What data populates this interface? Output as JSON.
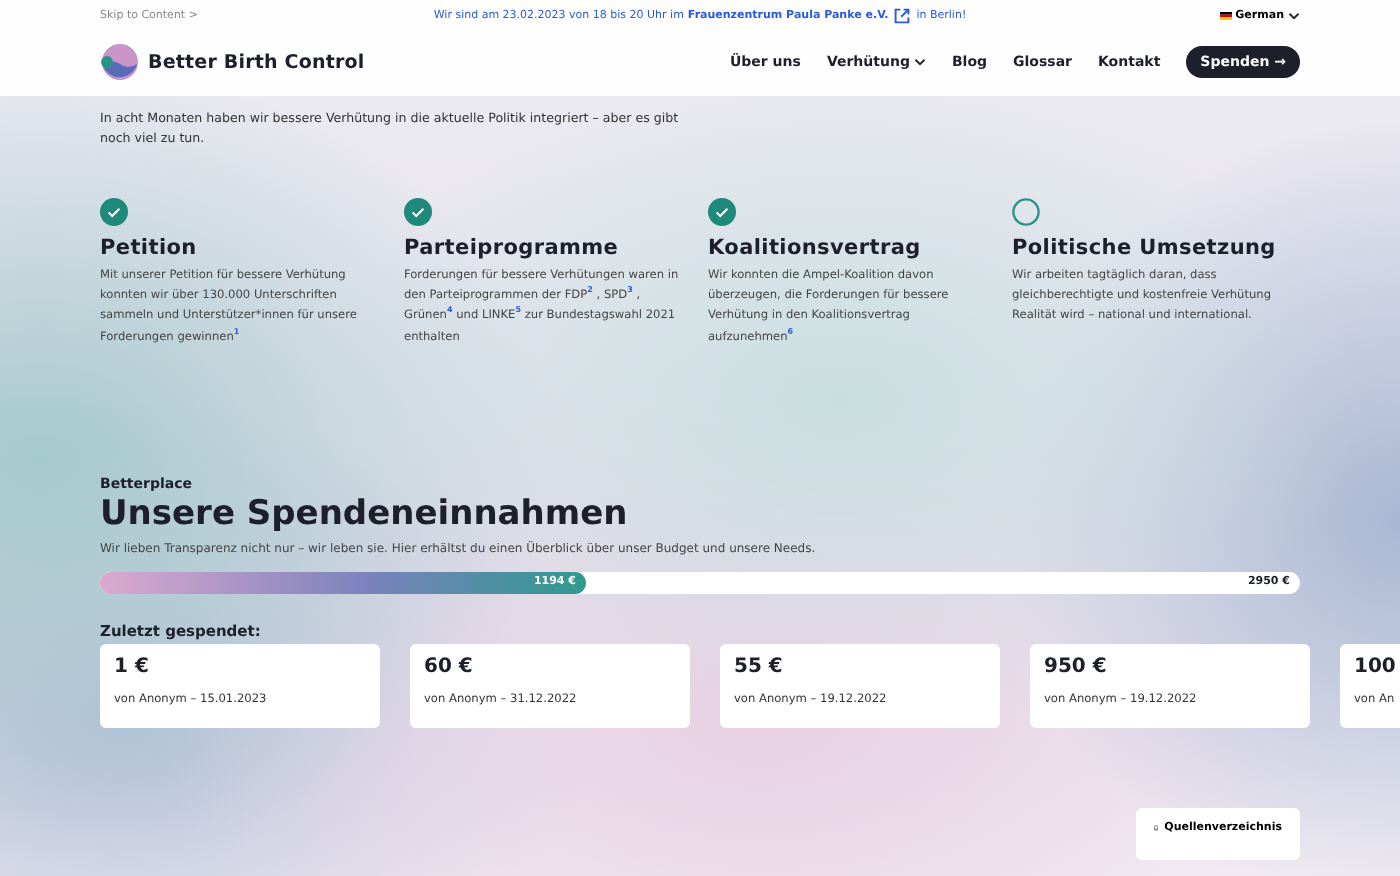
{
  "topbar": {
    "skip_link": "Skip to Content >",
    "announcement": {
      "before": "Wir sind am 23.02.2023 von 18 bis 20 Uhr im",
      "link": "Frauenzentrum Paula Panke e.V.",
      "after": "in Berlin!"
    },
    "language": "German"
  },
  "nav": {
    "logo": "Better Birth Control",
    "items": [
      {
        "label": "Über uns",
        "dropdown": false
      },
      {
        "label": "Verhütung",
        "dropdown": true
      },
      {
        "label": "Blog",
        "dropdown": false
      },
      {
        "label": "Glossar",
        "dropdown": false
      },
      {
        "label": "Kontakt",
        "dropdown": false
      }
    ],
    "cta": "Spenden →"
  },
  "intro": "In acht Monaten haben wir bessere Verhütung in die aktuelle Politik integriert – aber es gibt noch viel zu tun.",
  "milestones": [
    {
      "title": "Petition",
      "done": true,
      "text": "Mit unserer Petition für bessere Verhütung konnten wir über 130.000 Unterschriften sammeln und Unterstützer*innen für unsere Forderungen gewinnen$^{1}$"
    },
    {
      "title": "Parteiprogramme",
      "done": true,
      "text": "Forderungen für bessere Verhütungen waren in den Parteiprogrammen der FDP$^{2}$ , SPD$^{3}$ , Grünen$^{4}$ und LINKE$^{5}$ zur Bundestagswahl 2021 enthalten"
    },
    {
      "title": "Koalitionsvertrag",
      "done": true,
      "text": "Wir konnten die Ampel-Koalition davon überzeugen, die Forderungen für bessere Verhütung in den Koalitionsvertrag aufzunehmen$^{6}$"
    },
    {
      "title": "Politische Umsetzung",
      "done": false,
      "text": "Wir arbeiten tagtäglich daran, dass gleichberechtigte und kostenfreie Verhütung Realität wird – national und international."
    }
  ],
  "donations": {
    "eyebrow": "Betterplace",
    "title": "Unsere Spendeneinnahmen",
    "subtitle": "Wir lieben Transparenz nicht nur – wir leben sie. Hier erhältst du einen Überblick über unser Budget und unsere Needs.",
    "progress": {
      "level": 0.405,
      "current": "1194 €",
      "goal": "2950 €"
    },
    "recent_label": "Zuletzt gespendet:",
    "recent": [
      {
        "amount": "1 €",
        "by": "von Anonym – 15.01.2023"
      },
      {
        "amount": "60 €",
        "by": "von Anonym – 31.12.2022"
      },
      {
        "amount": "55 €",
        "by": "von Anonym – 19.12.2022"
      },
      {
        "amount": "950 €",
        "by": "von Anonym – 19.12.2022"
      },
      {
        "amount": "100",
        "by": "von An"
      }
    ]
  },
  "sources_button": "Quellenverzeichnis"
}
